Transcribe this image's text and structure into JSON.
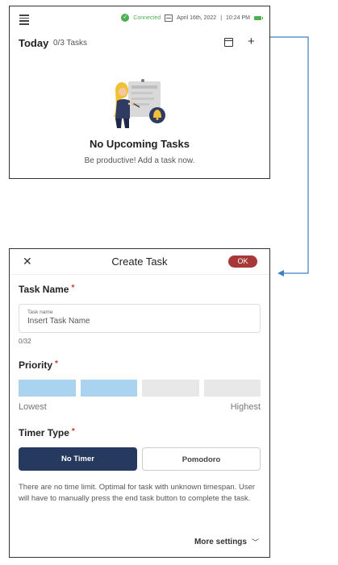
{
  "home": {
    "status": {
      "connection": "Connected",
      "date": "April 16th, 2022",
      "time": "10:24 PM"
    },
    "title": "Today",
    "task_count": "0/3 Tasks",
    "empty_state": {
      "title": "No Upcoming Tasks",
      "subtitle": "Be productive! Add a task now."
    }
  },
  "create_task": {
    "header_title": "Create Task",
    "ok_label": "OK",
    "task_name_label": "Task Name",
    "required_marker": "*",
    "task_name_field": {
      "floating_label": "Task name",
      "placeholder": "Insert Task Name"
    },
    "char_count": "0/32",
    "priority_label": "Priority",
    "priority": {
      "segments": 4,
      "selected": 2,
      "low_label": "Lowest",
      "high_label": "Highest"
    },
    "timer_type_label": "Timer Type",
    "timer_options": [
      "No Timer",
      "Pomodoro"
    ],
    "timer_selected": "No Timer",
    "timer_description": "There are no time limit. Optimal for task with unknown timespan. User will have to manually press the end task button to complete the task.",
    "more_settings_label": "More settings"
  },
  "colors": {
    "accent_ok": "#a83838",
    "priority_selected": "#a9d3ee",
    "priority_unselected": "#e8e8e8",
    "timer_selected_bg": "#253a5e",
    "connected_green": "#4caf50",
    "connector_blue": "#3d7fc4"
  }
}
